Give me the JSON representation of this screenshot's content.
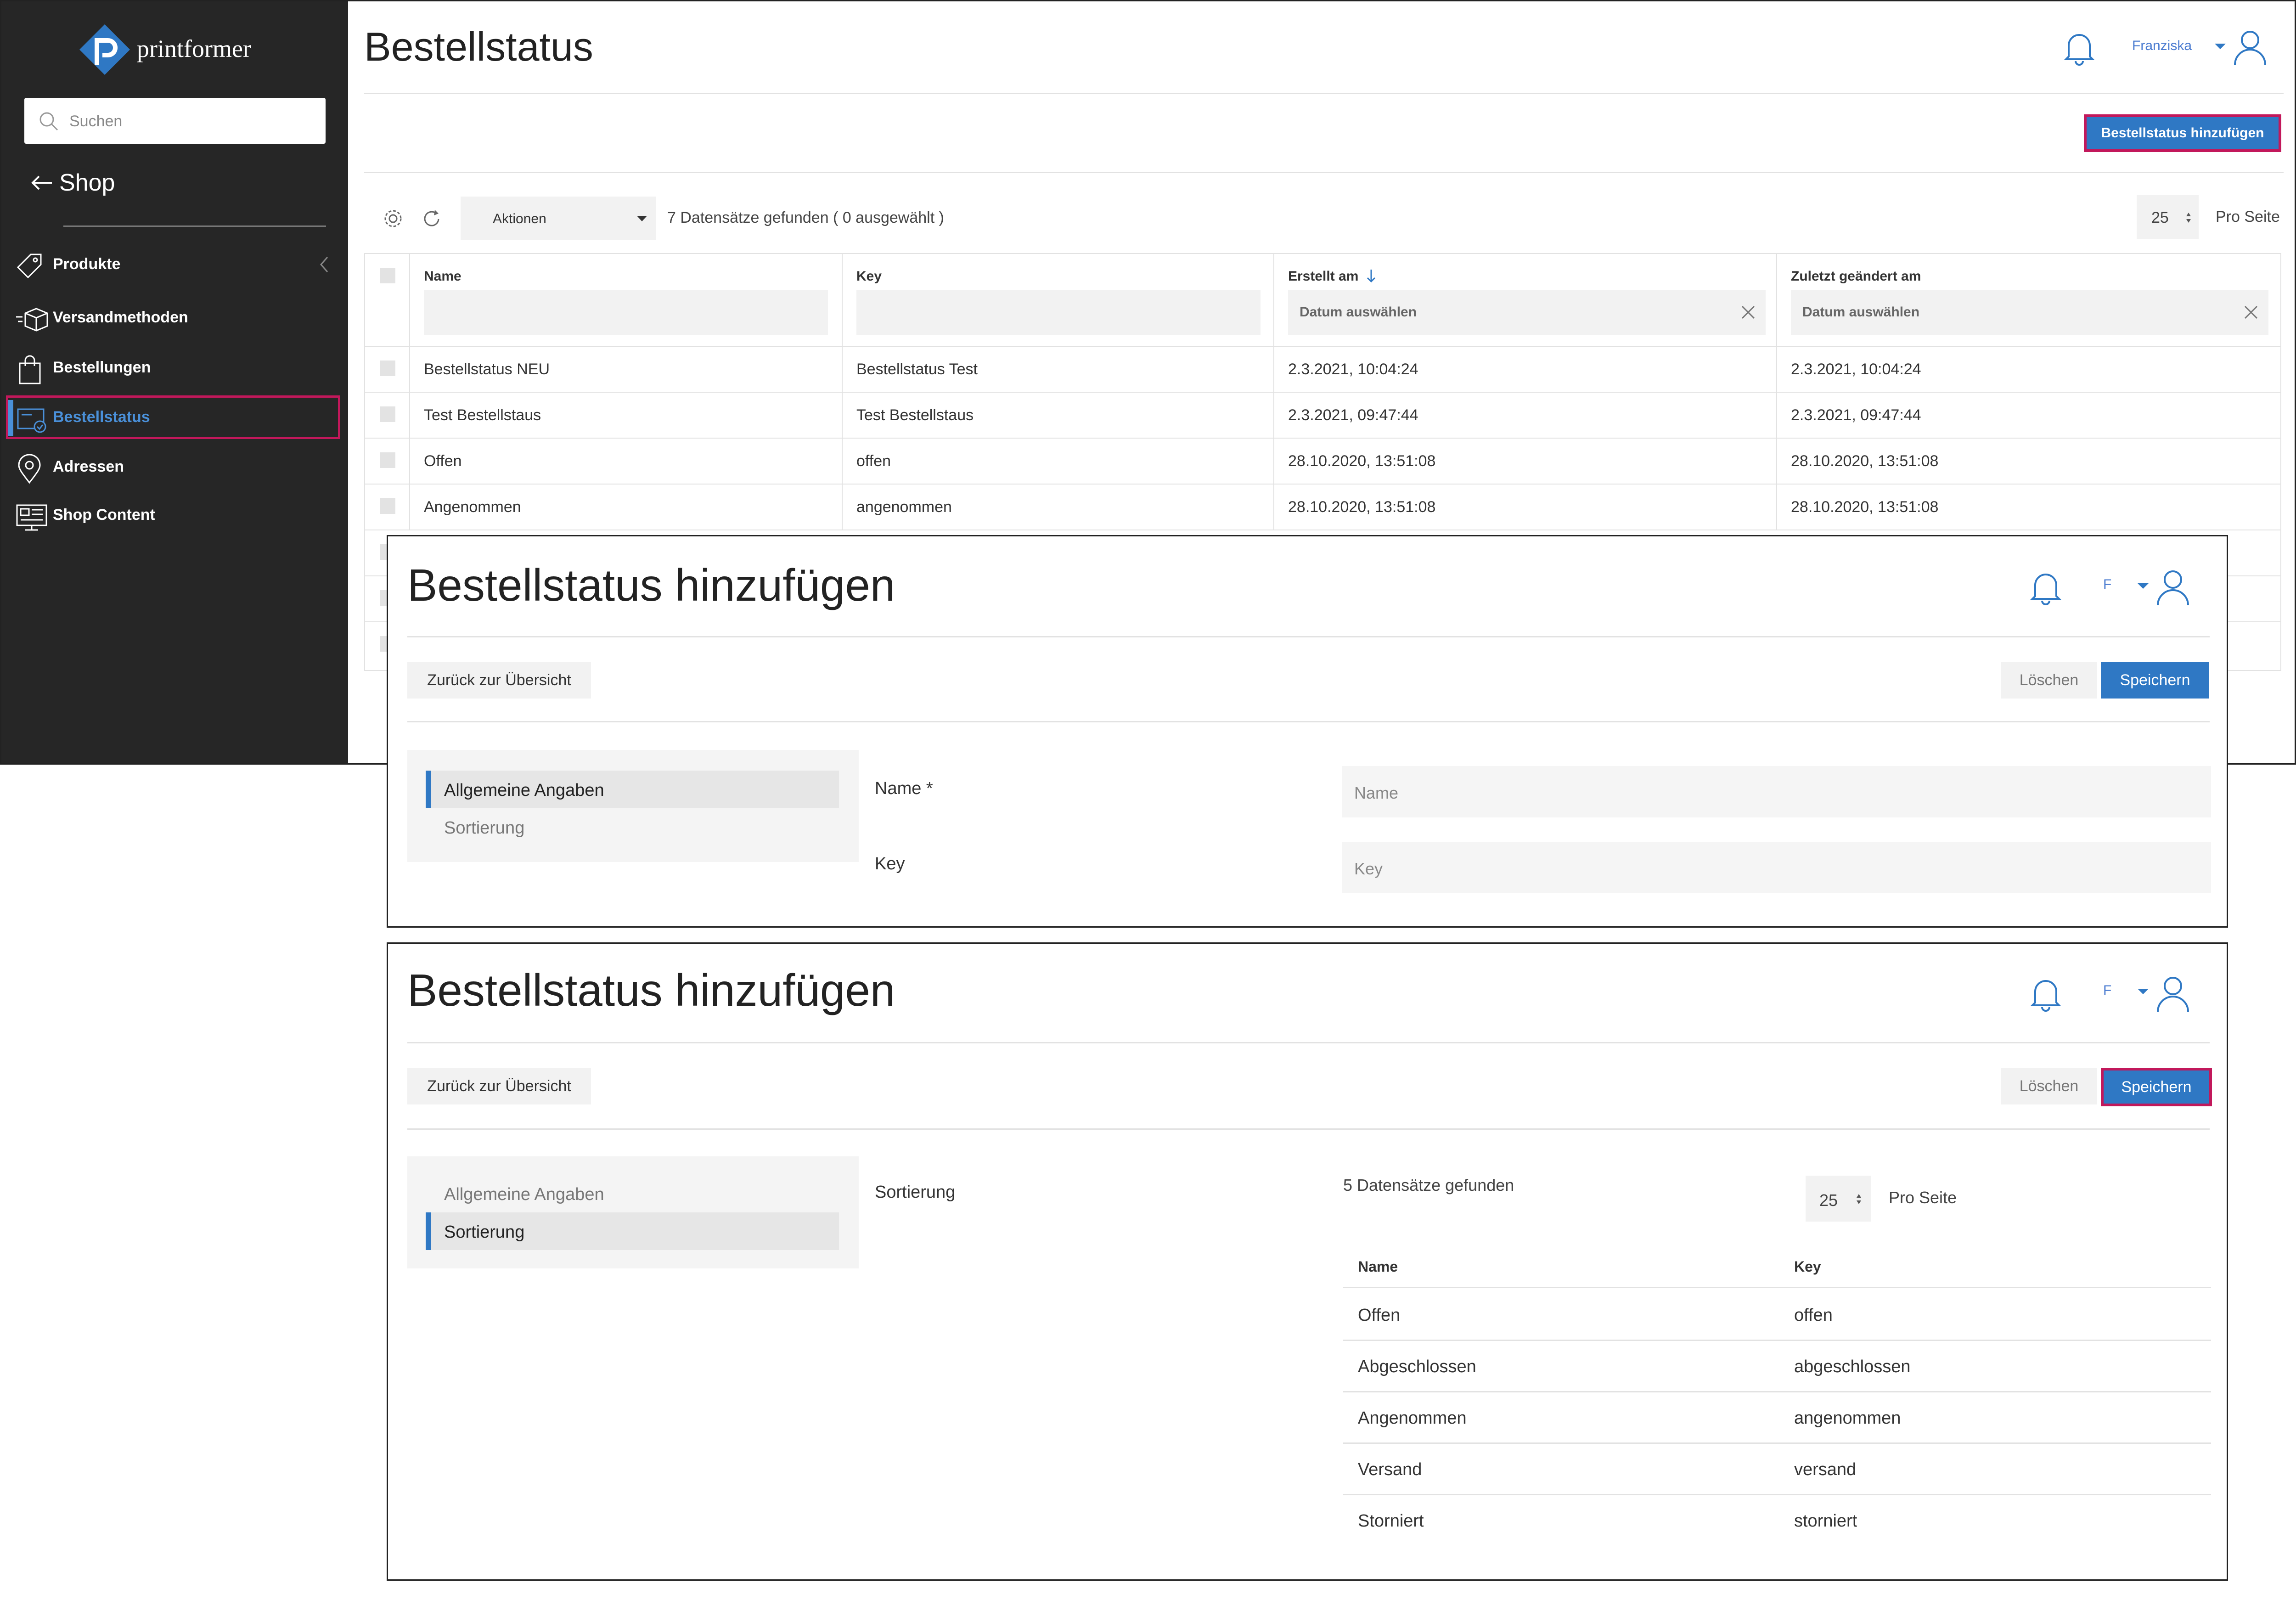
{
  "overview": {
    "brand": "printformer",
    "search_placeholder": "Suchen",
    "back_label": "Shop",
    "nav": [
      "Produkte",
      "Versandmethoden",
      "Bestellungen",
      "Bestellstatus",
      "Adressen",
      "Shop Content"
    ],
    "title": "Bestellstatus",
    "user": "Franziska",
    "add_button": "Bestellstatus hinzufügen",
    "actions_label": "Aktionen",
    "records_found": "7 Datensätze gefunden ( 0 ausgewählt )",
    "per_page": "25",
    "per_page_label": "Pro Seite",
    "columns": {
      "name": "Name",
      "key": "Key",
      "created": "Erstellt am",
      "modified": "Zuletzt geändert am",
      "date_placeholder": "Datum auswählen"
    },
    "rows": [
      {
        "name": "Bestellstatus NEU",
        "key": "Bestellstatus Test",
        "created": "2.3.2021, 10:04:24",
        "modified": "2.3.2021, 10:04:24"
      },
      {
        "name": "Test Bestellstaus",
        "key": "Test Bestellstaus",
        "created": "2.3.2021, 09:47:44",
        "modified": "2.3.2021, 09:47:44"
      },
      {
        "name": "Offen",
        "key": "offen",
        "created": "28.10.2020, 13:51:08",
        "modified": "28.10.2020, 13:51:08"
      },
      {
        "name": "Angenommen",
        "key": "angenommen",
        "created": "28.10.2020, 13:51:08",
        "modified": "28.10.2020, 13:51:08"
      }
    ]
  },
  "form_general": {
    "title": "Bestellstatus hinzufügen",
    "user_initial": "F",
    "back_button": "Zurück zur Übersicht",
    "delete_button": "Löschen",
    "save_button": "Speichern",
    "nav": [
      "Allgemeine Angaben",
      "Sortierung"
    ],
    "name_label": "Name *",
    "name_placeholder": "Name",
    "key_label": "Key",
    "key_placeholder": "Key"
  },
  "form_sorting": {
    "title": "Bestellstatus hinzufügen",
    "user_initial": "F",
    "back_button": "Zurück zur Übersicht",
    "delete_button": "Löschen",
    "save_button": "Speichern",
    "nav": [
      "Allgemeine Angaben",
      "Sortierung"
    ],
    "section_label": "Sortierung",
    "records_found": "5 Datensätze gefunden",
    "per_page": "25",
    "per_page_label": "Pro Seite",
    "columns": [
      "Name",
      "Key"
    ],
    "rows": [
      {
        "name": "Offen",
        "key": "offen"
      },
      {
        "name": "Abgeschlossen",
        "key": "abgeschlossen"
      },
      {
        "name": "Angenommen",
        "key": "angenommen"
      },
      {
        "name": "Versand",
        "key": "versand"
      },
      {
        "name": "Storniert",
        "key": "storniert"
      }
    ]
  },
  "colors": {
    "accent": "#2f78c4",
    "highlight": "#c2185b",
    "sidebar": "#262626"
  }
}
